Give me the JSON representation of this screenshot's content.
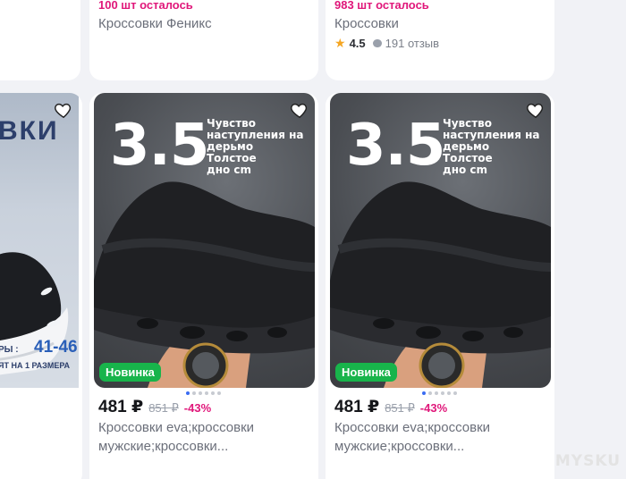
{
  "top_cards": [
    {
      "stock": "100 шт осталось",
      "name": "Кроссовки Феникс"
    },
    {
      "stock": "983 шт осталось",
      "name": "Кроссовки",
      "rating": "4.5",
      "reviews": "191 отзыв"
    }
  ],
  "left_card": {
    "title_fragment": "ВКИ",
    "size_range": "41-46",
    "size_prefix": "РЫ :",
    "size_note": "ЯТ НА 1 РАЗМЕРА"
  },
  "products": [
    {
      "promo_number": "3.5",
      "promo_text": [
        "Чувство",
        "наступления на",
        "дерьмо",
        "Толстое",
        "дно cm"
      ],
      "badge": "Новинка",
      "price": "481 ₽",
      "old_price": "851 ₽",
      "discount": "-43%",
      "desc_line1": "Кроссовки eva;кроссовки",
      "desc_line2": "мужские;кроссовки..."
    },
    {
      "promo_number": "3.5",
      "promo_text": [
        "Чувство",
        "наступления на",
        "дерьмо",
        "Толстое",
        "дно cm"
      ],
      "badge": "Новинка",
      "price": "481 ₽",
      "old_price": "851 ₽",
      "discount": "-43%",
      "desc_line1": "Кроссовки eva;кроссовки",
      "desc_line2": "мужские;кроссовки..."
    }
  ],
  "watermark": "MYSKU",
  "colors": {
    "accent_pink": "#e0177a",
    "badge_green": "#18b44b",
    "dot_active": "#3a6cf2"
  }
}
